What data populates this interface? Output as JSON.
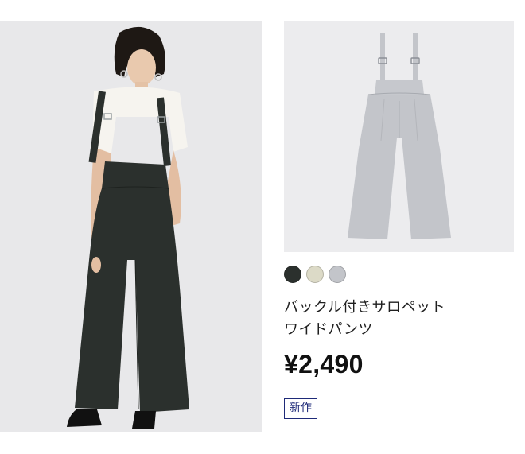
{
  "product": {
    "name_line1": "バックル付きサロペット",
    "name_line2": "ワイドパンツ",
    "price": "¥2,490",
    "badge": "新作",
    "swatches": [
      {
        "name": "dark-green",
        "color": "#2b302d"
      },
      {
        "name": "beige",
        "color": "#dcdac7"
      },
      {
        "name": "light-gray",
        "color": "#c3c5ca"
      }
    ]
  }
}
